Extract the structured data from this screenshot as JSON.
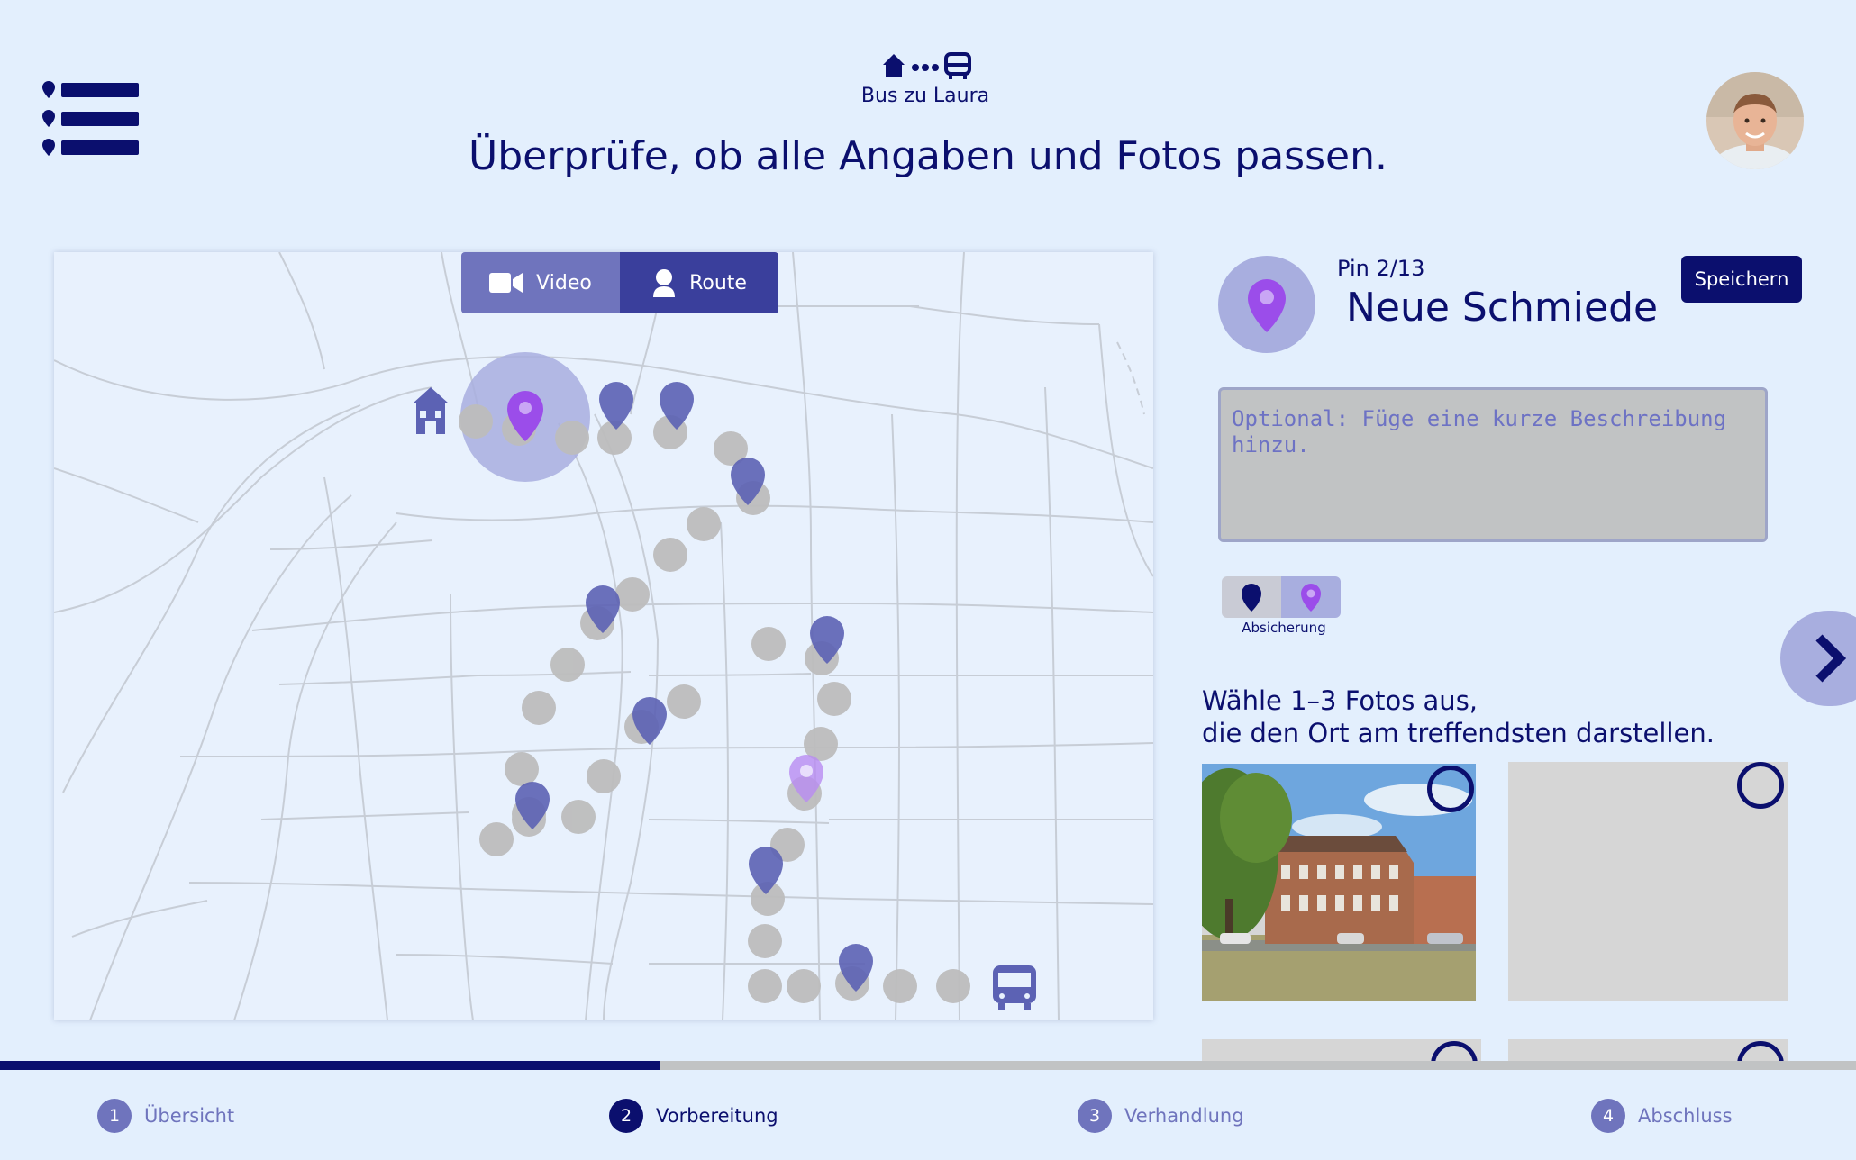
{
  "header": {
    "route_name": "Bus zu Laura",
    "page_title": "Überprüfe, ob alle Angaben und Fotos passen."
  },
  "map": {
    "view_toggle": {
      "video_label": "Video",
      "route_label": "Route",
      "active": "Route"
    }
  },
  "pin_panel": {
    "pin_index": "Pin 2/13",
    "pin_name": "Neue Schmiede",
    "save_label": "Speichern",
    "description_placeholder": "Optional: Füge eine kurze Beschreibung\nhinzu.",
    "pin_type_label": "Absicherung",
    "photo_hint": "Wähle 1–3 Fotos aus,\ndie den Ort am treffendsten darstellen."
  },
  "progress": {
    "fraction": 0.356
  },
  "steps": [
    {
      "number": "1",
      "label": "Übersicht",
      "active": false
    },
    {
      "number": "2",
      "label": "Vorbereitung",
      "active": true
    },
    {
      "number": "3",
      "label": "Verhandlung",
      "active": false
    },
    {
      "number": "4",
      "label": "Abschluss",
      "active": false
    }
  ],
  "colors": {
    "background": "#e3effd",
    "primary": "#0b0f6e",
    "accent_purple": "#9b4dea",
    "pin_blue": "#5c62b4",
    "route_dot": "#bdbdbd"
  },
  "icons": [
    "menu-icon",
    "home-icon",
    "bus-icon",
    "video-icon",
    "person-icon",
    "location-pin-icon",
    "chevron-right-icon"
  ]
}
